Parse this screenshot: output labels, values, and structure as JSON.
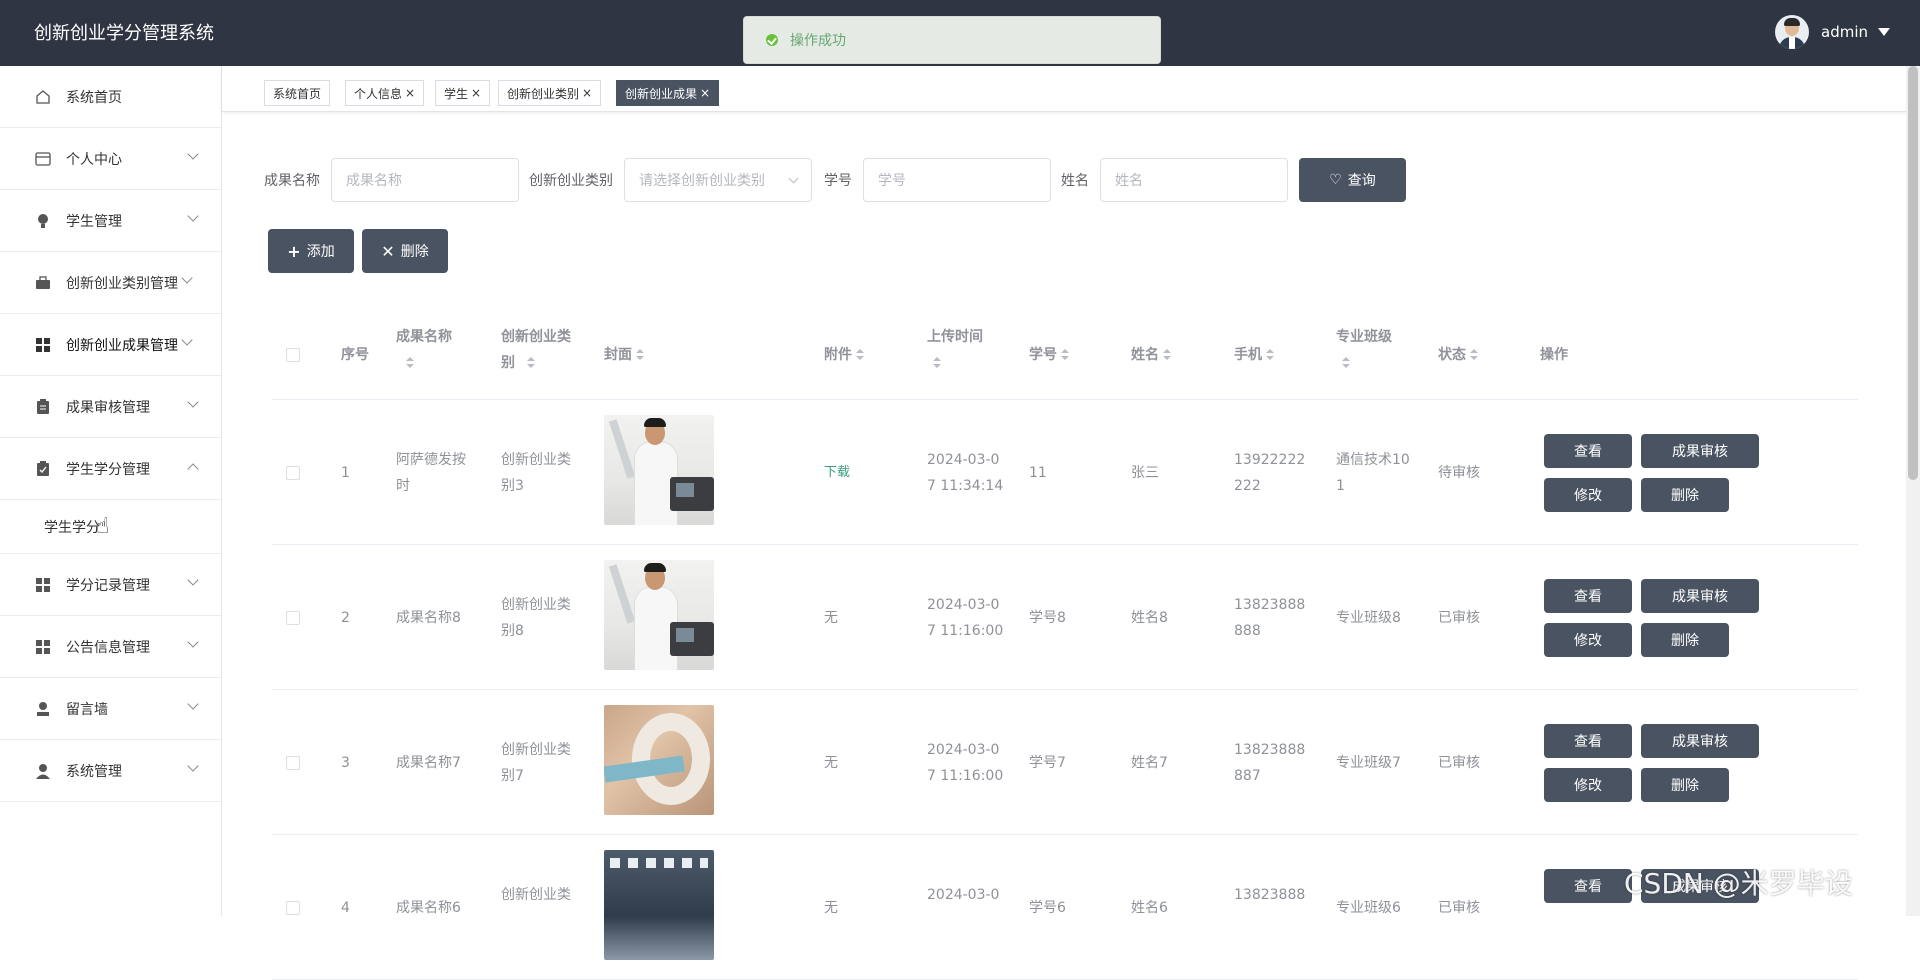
{
  "app": {
    "title": "创新创业学分管理系统"
  },
  "user": {
    "name": "admin"
  },
  "toast": {
    "message": "操作成功"
  },
  "sidebar": {
    "items": [
      {
        "label": "系统首页",
        "icon": "home-icon"
      },
      {
        "label": "个人中心",
        "icon": "card-icon"
      },
      {
        "label": "学生管理",
        "icon": "bulb-icon"
      },
      {
        "label": "创新创业类别管理",
        "icon": "briefcase-icon"
      },
      {
        "label": "创新创业成果管理",
        "icon": "grid-icon"
      },
      {
        "label": "成果审核管理",
        "icon": "clipboard-icon"
      },
      {
        "label": "学生学分管理",
        "icon": "clipboard-check-icon",
        "expanded": true
      },
      {
        "label": "学分记录管理",
        "icon": "grid-icon"
      },
      {
        "label": "公告信息管理",
        "icon": "grid-icon"
      },
      {
        "label": "留言墙",
        "icon": "user-icon"
      },
      {
        "label": "系统管理",
        "icon": "user-icon"
      }
    ],
    "sub_item": "学生学分"
  },
  "tabs": [
    {
      "label": "系统首页"
    },
    {
      "label": "个人信息"
    },
    {
      "label": "学生"
    },
    {
      "label": "创新创业类别"
    },
    {
      "label": "创新创业成果",
      "active": true
    }
  ],
  "search": {
    "name_label": "成果名称",
    "name_placeholder": "成果名称",
    "category_label": "创新创业类别",
    "category_placeholder": "请选择创新创业类别",
    "sid_label": "学号",
    "sid_placeholder": "学号",
    "sname_label": "姓名",
    "sname_placeholder": "姓名",
    "query_label": "查询"
  },
  "toolbar": {
    "add_label": "添加",
    "delete_label": "删除"
  },
  "table": {
    "headers": {
      "seq": "序号",
      "name": "成果名称",
      "category_l1": "创新创业类",
      "category_l2": "别",
      "cover": "封面",
      "attachment": "附件",
      "upload_time": "上传时间",
      "student_id": "学号",
      "student_name": "姓名",
      "phone": "手机",
      "major_class": "专业班级",
      "status": "状态",
      "ops": "操作"
    },
    "rows": [
      {
        "seq": "1",
        "name_l1": "阿萨德发按",
        "name_l2": "时",
        "cat_l1": "创新创业类",
        "cat_l2": "别3",
        "attach": "下载",
        "time_l1": "2024-03-0",
        "time_l2": "7 11:34:14",
        "sid": "11",
        "sname": "张三",
        "phone_l1": "13922222",
        "phone_l2": "222",
        "class_l1": "通信技术10",
        "class_l2": "1",
        "status": "待审核"
      },
      {
        "seq": "2",
        "name_l1": "成果名称8",
        "name_l2": "",
        "cat_l1": "创新创业类",
        "cat_l2": "别8",
        "attach": "无",
        "time_l1": "2024-03-0",
        "time_l2": "7 11:16:00",
        "sid": "学号8",
        "sname": "姓名8",
        "phone_l1": "13823888",
        "phone_l2": "888",
        "class_l1": "专业班级8",
        "class_l2": "",
        "status": "已审核"
      },
      {
        "seq": "3",
        "name_l1": "成果名称7",
        "name_l2": "",
        "cat_l1": "创新创业类",
        "cat_l2": "别7",
        "attach": "无",
        "time_l1": "2024-03-0",
        "time_l2": "7 11:16:00",
        "sid": "学号7",
        "sname": "姓名7",
        "phone_l1": "13823888",
        "phone_l2": "887",
        "class_l1": "专业班级7",
        "class_l2": "",
        "status": "已审核"
      },
      {
        "seq": "4",
        "name_l1": "成果名称6",
        "name_l2": "",
        "cat_l1": "创新创业类",
        "cat_l2": "",
        "attach": "无",
        "time_l1": "2024-03-0",
        "time_l2": "",
        "sid": "学号6",
        "sname": "姓名6",
        "phone_l1": "13823888",
        "phone_l2": "",
        "class_l1": "专业班级6",
        "class_l2": "",
        "status": "已审核"
      }
    ],
    "row_actions": {
      "view": "查看",
      "review": "成果审核",
      "edit": "修改",
      "delete": "删除"
    }
  },
  "watermark": "CSDN @米罗毕设"
}
